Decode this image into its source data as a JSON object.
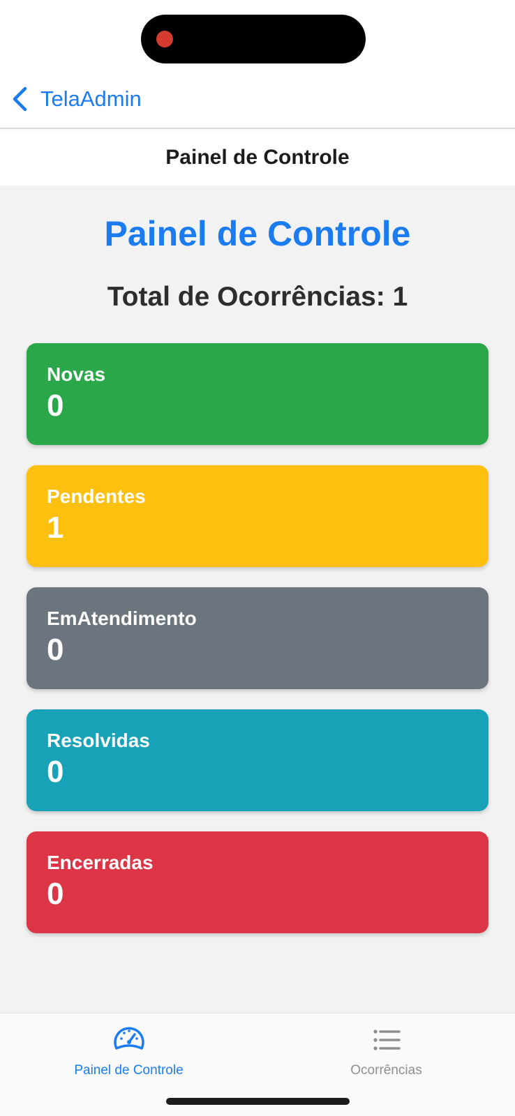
{
  "nav": {
    "back_label": "TelaAdmin",
    "header_title": "Painel de Controle"
  },
  "main": {
    "title": "Painel de Controle",
    "total_text": "Total de Ocorrências: 1",
    "cards": [
      {
        "label": "Novas",
        "value": "0",
        "color": "#2aa748"
      },
      {
        "label": "Pendentes",
        "value": "1",
        "color": "#fdc00e"
      },
      {
        "label": "EmAtendimento",
        "value": "0",
        "color": "#6c757d"
      },
      {
        "label": "Resolvidas",
        "value": "0",
        "color": "#17a2b8"
      },
      {
        "label": "Encerradas",
        "value": "0",
        "color": "#dc3545"
      }
    ]
  },
  "tabbar": {
    "tabs": [
      {
        "label": "Painel de Controle",
        "icon": "speedometer-icon",
        "active": true
      },
      {
        "label": "Ocorrências",
        "icon": "list-icon",
        "active": false
      }
    ],
    "active_color": "#1a7cf0",
    "inactive_color": "#8e8e93"
  },
  "colors": {
    "accent": "#1a7cf0"
  }
}
